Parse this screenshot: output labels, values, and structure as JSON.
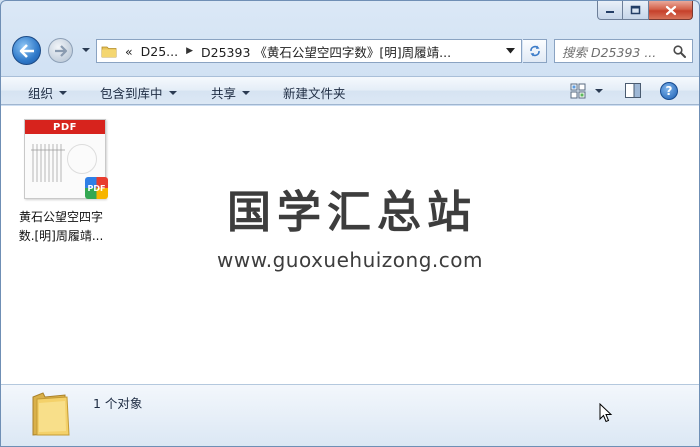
{
  "window": {
    "caption_buttons": [
      "minimize",
      "maximize",
      "close"
    ]
  },
  "address_bar": {
    "crumbs": [
      "D25...",
      "D25393 《黄石公望空四字数》[明]周履靖..."
    ],
    "overflow": "«"
  },
  "search": {
    "placeholder": "搜索 D25393 ..."
  },
  "toolbar": {
    "organize": "组织",
    "include_in_library": "包含到库中",
    "share": "共享",
    "new_folder": "新建文件夹"
  },
  "files": [
    {
      "name_line1": "黄石公望空四字",
      "name_line2": "数.[明]周履靖...",
      "thumb_label": "PDF",
      "badge_label": "PDF"
    }
  ],
  "watermark": {
    "title": "国学汇总站",
    "url": "www.guoxuehuizong.com"
  },
  "details": {
    "count": "1 个对象"
  },
  "colors": {
    "accent_red": "#d7231d",
    "chrome_blue": "#c9dcf1"
  }
}
